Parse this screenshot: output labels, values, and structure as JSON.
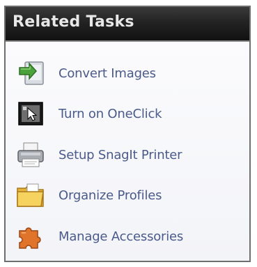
{
  "panel": {
    "title": "Related Tasks"
  },
  "tasks": [
    {
      "label": "Convert Images",
      "icon": "convert-images-icon"
    },
    {
      "label": "Turn on OneClick",
      "icon": "oneclick-icon"
    },
    {
      "label": "Setup SnagIt Printer",
      "icon": "printer-icon"
    },
    {
      "label": "Organize Profiles",
      "icon": "folder-icon"
    },
    {
      "label": "Manage Accessories",
      "icon": "puzzle-piece-icon"
    }
  ],
  "colors": {
    "header_bg": "#1c1c1c",
    "header_text": "#e8e8e8",
    "link_text": "#4a5a8a",
    "panel_border": "#6e6e6e"
  }
}
